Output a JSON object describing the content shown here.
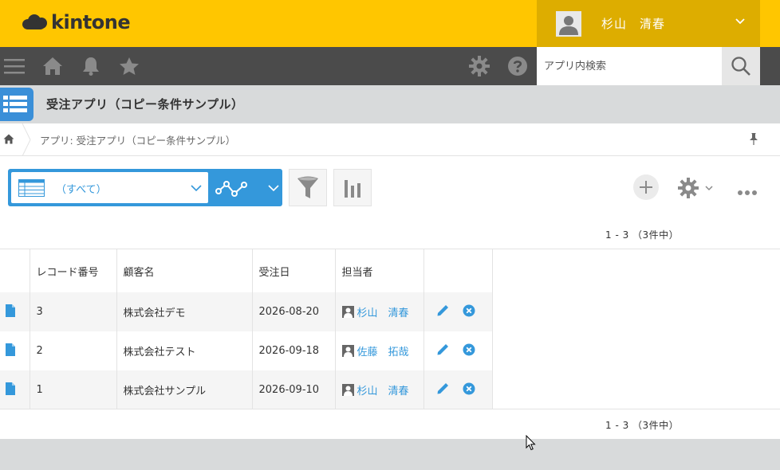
{
  "header": {
    "logo_text": "kintone",
    "user_name": "杉山　清春"
  },
  "navbar": {
    "search_placeholder": "アプリ内検索"
  },
  "app": {
    "title": "受注アプリ（コピー条件サンプル）",
    "breadcrumb": "アプリ: 受注アプリ（コピー条件サンプル）"
  },
  "toolbar": {
    "view_label": "（すべて）"
  },
  "pagination": {
    "top": "1 - 3 （3件中）",
    "bottom": "1 - 3 （3件中）"
  },
  "table": {
    "headers": [
      "レコード番号",
      "顧客名",
      "受注日",
      "担当者"
    ],
    "rows": [
      {
        "no": "3",
        "customer": "株式会社デモ",
        "date": "2026-08-20",
        "person": "杉山　清春"
      },
      {
        "no": "2",
        "customer": "株式会社テスト",
        "date": "2026-09-18",
        "person": "佐藤　拓哉"
      },
      {
        "no": "1",
        "customer": "株式会社サンプル",
        "date": "2026-09-10",
        "person": "杉山　清春"
      }
    ]
  },
  "colors": {
    "header_yellow": "#ffc600",
    "user_box": "#ddad00",
    "nav_dark": "#4b4b4b",
    "accent_blue": "#3498db"
  }
}
